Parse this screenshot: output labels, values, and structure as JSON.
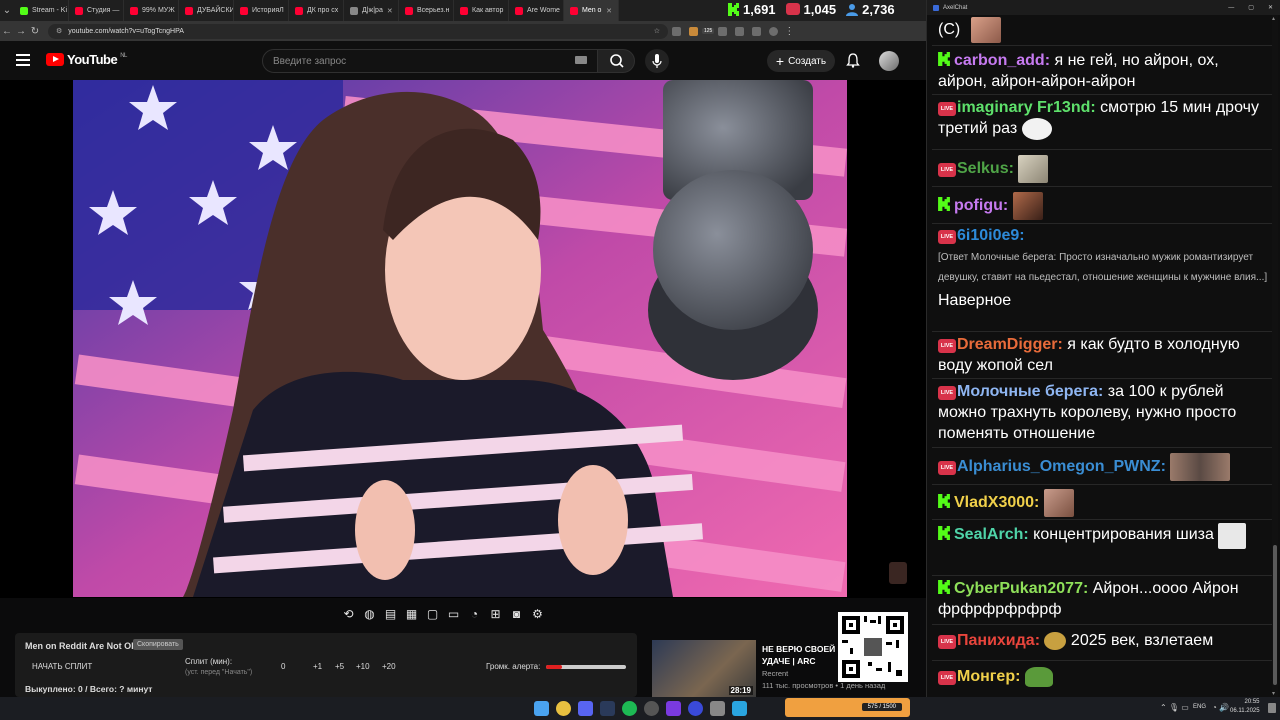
{
  "browser": {
    "tabs": [
      {
        "label": "Stream - Ki",
        "color": "#53fc18"
      },
      {
        "label": "Студия — ",
        "color": "#ff0033"
      },
      {
        "label": "99% МУЖ",
        "color": "#ff0033"
      },
      {
        "label": "ДУБАЙСКИ",
        "color": "#ff0033"
      },
      {
        "label": "ИсторияЛ",
        "color": "#ff0033"
      },
      {
        "label": "ДК про сх",
        "color": "#ff0033"
      },
      {
        "label": "Д|ж|ра",
        "color": "#888888"
      },
      {
        "label": "Всерьез.н",
        "color": "#ff0033"
      },
      {
        "label": "Как автор",
        "color": "#ff0033"
      },
      {
        "label": "Are Wome",
        "color": "#ff0033"
      },
      {
        "label": "Men o",
        "color": "#ff0033"
      }
    ],
    "url": "youtube.com/watch?v=uTogTcngHPA",
    "badge": "125"
  },
  "youtube": {
    "logo": "YouTube",
    "region": "NL",
    "search_placeholder": "Введите запрос",
    "create_label": "Создать"
  },
  "stats": {
    "kick_viewers": "1,691",
    "live_viewers": "1,045",
    "total_viewers": "2,736"
  },
  "split": {
    "title": "Men on Reddit Are Not Ok",
    "copy_label": "Скопировать",
    "start_button": "НАЧАТЬ СПЛИТ",
    "split_label": "Сплит (мин):",
    "split_hint": "(уст. перед \"Начать\")",
    "value": "0",
    "inc": [
      "+1",
      "+5",
      "+10",
      "+20"
    ],
    "volume_label": "Громк. алерта:",
    "volume_level": 0.2,
    "bought": "Выкуплено: 0 / Всего: ? минут"
  },
  "recommendation": {
    "title": "НЕ ВЕРЮ СВОЕЙ УДАЧЕ | ARC RAIDERS",
    "channel": "Recrent",
    "meta": "111 тыс. просмотров • 1 день назад",
    "duration": "28:19"
  },
  "chat": {
    "window_title": "AxelChat",
    "messages": [
      {
        "platform": "",
        "user": "",
        "user_color": "#ffffff",
        "text": "(С)"
      },
      {
        "platform": "kick",
        "user": "carbon_add:",
        "user_color": "#c67af0",
        "text": "я не гей, но айрон, ох, айрон, айрон-айрон-айрон"
      },
      {
        "platform": "live",
        "user": "imaginary Fr13nd:",
        "user_color": "#5ee06b",
        "text": "смотрю 15 мин дрочу третий раз"
      },
      {
        "platform": "live",
        "user": "Selkus:",
        "user_color": "#4fa447",
        "text": ""
      },
      {
        "platform": "kick",
        "user": "pofigu:",
        "user_color": "#c67af0",
        "text": ""
      },
      {
        "platform": "live",
        "user": "6i10i0e9:",
        "user_color": "#2d8ad8",
        "text": "",
        "reply": "[Ответ Молочные берега: Просто изначально мужик романтизирует девушку, ставит на пьедестал, отношение женщины к мужчине влия...]",
        "reply_text": "Наверное"
      },
      {
        "platform": "live",
        "user": "DreamDigger:",
        "user_color": "#e86b3a",
        "text": "я как будто в холодную воду жопой сел"
      },
      {
        "platform": "live",
        "user": "Молочные берега:",
        "user_color": "#8fb6f2",
        "text": "за 100 к рублей можно трахнуть королеву, нужно просто поменять отношение"
      },
      {
        "platform": "live",
        "user": "Alpharius_Omegon_PWNZ:",
        "user_color": "#3a8dd3",
        "text": ""
      },
      {
        "platform": "kick",
        "user": "VladX3000:",
        "user_color": "#f0d04a",
        "text": ""
      },
      {
        "platform": "kick",
        "user": "SealArch:",
        "user_color": "#4fd4a8",
        "text": "концентрирования шиза"
      },
      {
        "platform": "kick",
        "user": "CyberPukan2077:",
        "user_color": "#8fe05a",
        "text": "Айрон...оооо Айрон фрфрфрфрфрф"
      },
      {
        "platform": "live",
        "user": "Панихида:",
        "user_color": "#e8453c",
        "text": "2025 век, взлетаем"
      },
      {
        "platform": "live",
        "user": "Монгер:",
        "user_color": "#f0d04a",
        "text": ""
      }
    ]
  },
  "taskbar": {
    "lang": "ENG",
    "time": "20:55",
    "date": "06.11.2025",
    "widget": "575 / 1500"
  }
}
